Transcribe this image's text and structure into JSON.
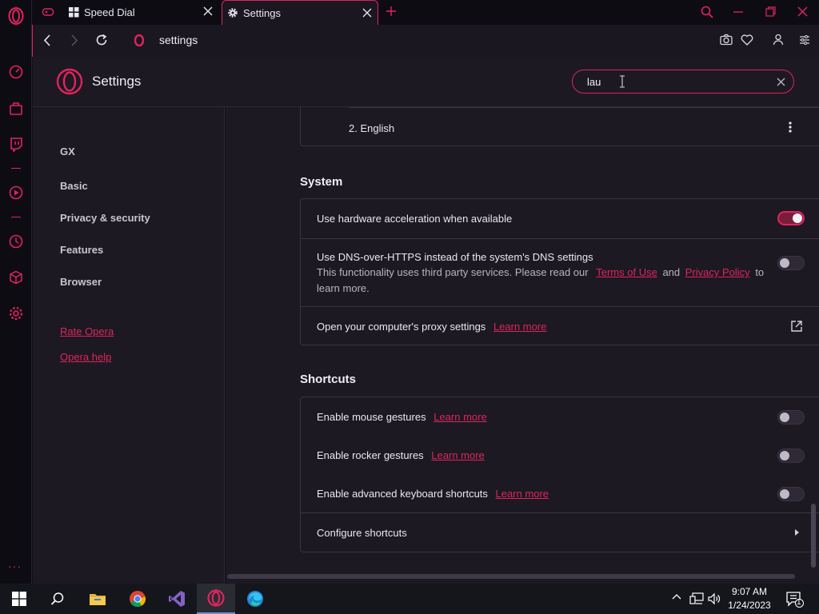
{
  "tabs": [
    {
      "label": "Speed Dial"
    },
    {
      "label": "Settings"
    }
  ],
  "address": {
    "text": "settings"
  },
  "header": {
    "title": "Settings",
    "search_value": "lau"
  },
  "nav": {
    "items": [
      "GX",
      "Basic",
      "Privacy & security",
      "Features",
      "Browser"
    ],
    "links": [
      "Rate Opera",
      "Opera help"
    ]
  },
  "language_row": {
    "label": "2. English"
  },
  "system": {
    "title": "System",
    "hw_accel": {
      "label": "Use hardware acceleration when available",
      "enabled": true
    },
    "dns": {
      "label": "Use DNS-over-HTTPS instead of the system's DNS settings",
      "desc_prefix": "This functionality uses third party services. Please read our",
      "terms": "Terms of Use",
      "and": "and",
      "privacy": "Privacy Policy",
      "desc_suffix": "to",
      "desc_line2": "learn more.",
      "enabled": false
    },
    "proxy": {
      "label": "Open your computer's proxy settings",
      "link": "Learn more"
    }
  },
  "shortcuts": {
    "title": "Shortcuts",
    "mouse": {
      "label": "Enable mouse gestures",
      "link": "Learn more",
      "enabled": false
    },
    "rocker": {
      "label": "Enable rocker gestures",
      "link": "Learn more",
      "enabled": false
    },
    "keyboard": {
      "label": "Enable advanced keyboard shortcuts",
      "link": "Learn more",
      "enabled": false
    },
    "configure": {
      "label": "Configure shortcuts"
    }
  },
  "taskbar": {
    "time": "9:07 AM",
    "date": "1/24/2023",
    "notifications": "1"
  },
  "colors": {
    "accent": "#e0245e",
    "bg": "#1c1922"
  }
}
